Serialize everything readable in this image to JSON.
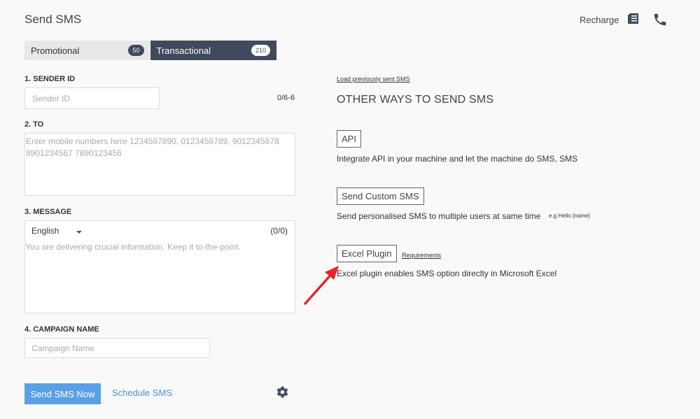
{
  "header": {
    "title": "Send SMS",
    "recharge_label": "Recharge",
    "doc_icon": "document-list-icon",
    "phone_icon": "phone-icon"
  },
  "tabs": [
    {
      "label": "Promotional",
      "count": "50",
      "active": false
    },
    {
      "label": "Transactional",
      "count": "210",
      "active": true
    }
  ],
  "form": {
    "sender_label": "1. SENDER ID",
    "sender_placeholder": "Sender ID",
    "sender_count": "0/6-6",
    "to_label": "2. TO",
    "to_placeholder": "Enter mobile numbers here 1234567890, 0123456789, 9012345678 8901234567 7890123456",
    "message_label": "3. MESSAGE",
    "language": "English",
    "message_count": "(0/0)",
    "message_placeholder": "You are delivering crucial information. Keep it to-the-point.",
    "campaign_label": "4. CAMPAIGN NAME",
    "campaign_placeholder": "Campaign Name"
  },
  "actions": {
    "send_label": "Send SMS Now",
    "schedule_label": "Schedule SMS",
    "settings_icon": "gear-icon"
  },
  "other": {
    "load_previous": "Load previously sent SMS",
    "title": "OTHER WAYS TO SEND SMS",
    "api_label": "API",
    "api_desc": "Integrate API in your machine and let the machine do SMS, SMS",
    "custom_label": "Send Custom SMS",
    "custom_desc": "Send personalised SMS to multiple users at same time",
    "custom_hint": "e.g Hello {name}",
    "excel_label": "Excel Plugin",
    "requirements_label": "Requirements",
    "excel_desc": "Excel plugin enables SMS option direclty in Microsoft Excel"
  },
  "colors": {
    "accent": "#5aa0e6",
    "tab_active": "#3f4a5c",
    "annotation_arrow": "#e3262b"
  }
}
